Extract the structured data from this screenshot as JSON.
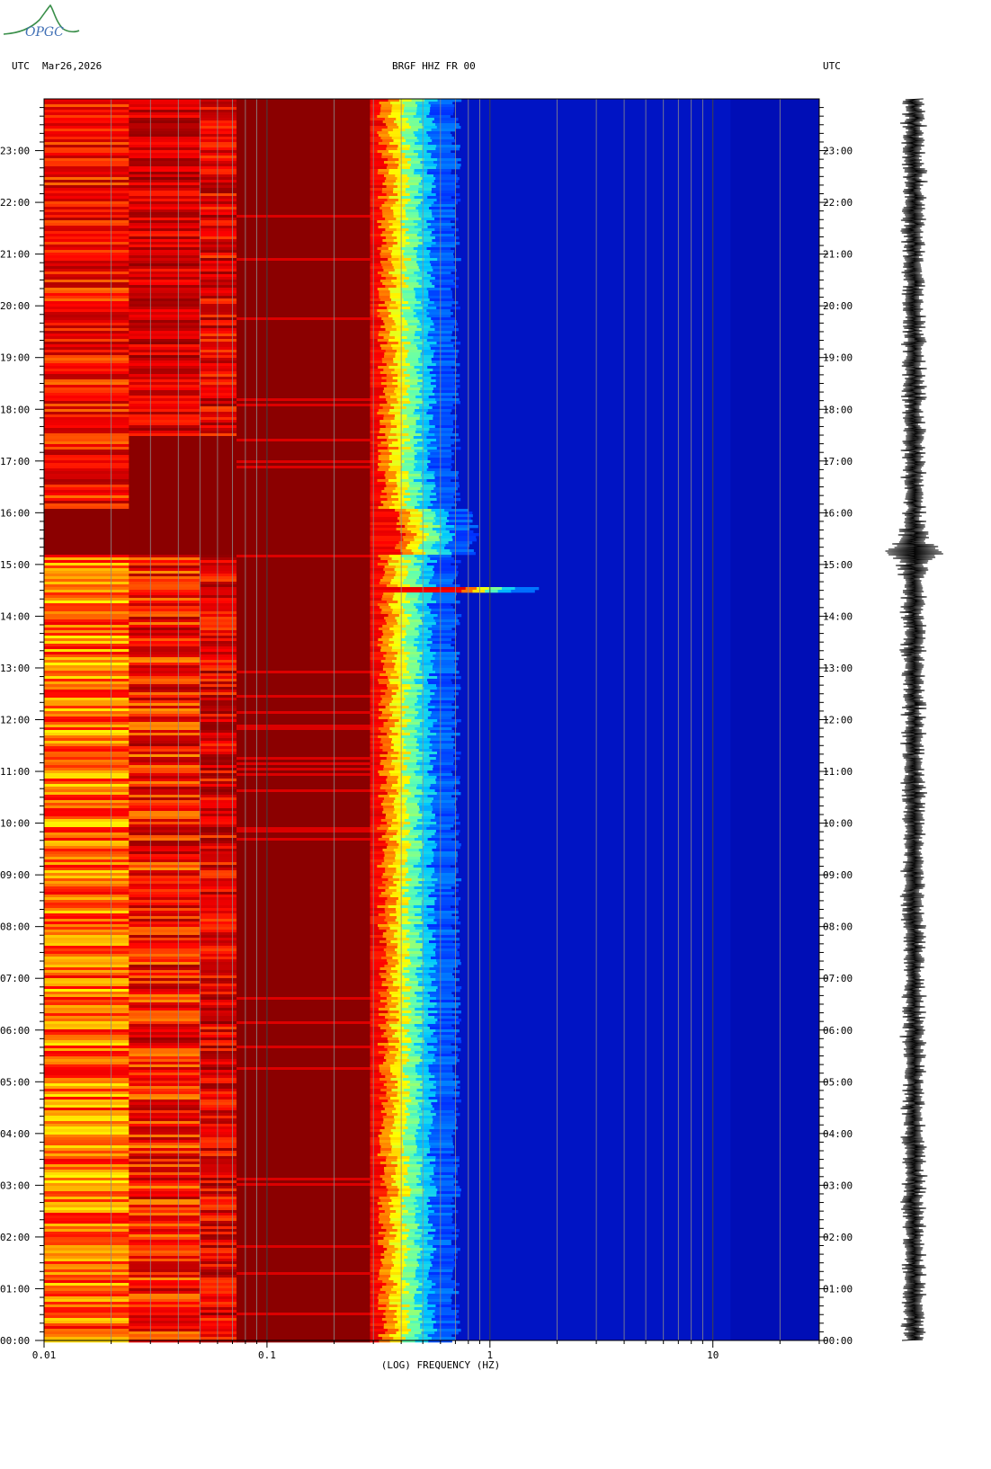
{
  "header": {
    "left_label": "UTC",
    "date": "Mar26,2026",
    "station": "BRGF HHZ FR 00",
    "right_label": "UTC"
  },
  "logo": {
    "text": "OPGC",
    "color": "#3a8f4a",
    "text_color": "#3f6fb5"
  },
  "chart_data": {
    "type": "heatmap",
    "title": "BRGF HHZ FR 00",
    "xlabel": "(LOG) FREQUENCY (HZ)",
    "x_scale": "log",
    "xlim": [
      0.01,
      30
    ],
    "x_ticks": [
      {
        "value": 0.01,
        "label": "0.01"
      },
      {
        "value": 0.1,
        "label": "0.1"
      },
      {
        "value": 1,
        "label": "1"
      },
      {
        "value": 10,
        "label": "10"
      }
    ],
    "y_unit": "hours UTC",
    "ylim": [
      0,
      24
    ],
    "y_ticks": [
      {
        "value": 0,
        "label": "00:00"
      },
      {
        "value": 1,
        "label": "01:00"
      },
      {
        "value": 2,
        "label": "02:00"
      },
      {
        "value": 3,
        "label": "03:00"
      },
      {
        "value": 4,
        "label": "04:00"
      },
      {
        "value": 5,
        "label": "05:00"
      },
      {
        "value": 6,
        "label": "06:00"
      },
      {
        "value": 7,
        "label": "07:00"
      },
      {
        "value": 8,
        "label": "08:00"
      },
      {
        "value": 9,
        "label": "09:00"
      },
      {
        "value": 10,
        "label": "10:00"
      },
      {
        "value": 11,
        "label": "11:00"
      },
      {
        "value": 12,
        "label": "12:00"
      },
      {
        "value": 13,
        "label": "13:00"
      },
      {
        "value": 14,
        "label": "14:00"
      },
      {
        "value": 15,
        "label": "15:00"
      },
      {
        "value": 16,
        "label": "16:00"
      },
      {
        "value": 17,
        "label": "17:00"
      },
      {
        "value": 18,
        "label": "18:00"
      },
      {
        "value": 19,
        "label": "19:00"
      },
      {
        "value": 20,
        "label": "20:00"
      },
      {
        "value": 21,
        "label": "21:00"
      },
      {
        "value": 22,
        "label": "22:00"
      },
      {
        "value": 23,
        "label": "23:00"
      }
    ],
    "frequency_bands_hz": [
      {
        "from": 0.01,
        "to": 0.024,
        "level": "high"
      },
      {
        "from": 0.024,
        "to": 0.05,
        "level": "very-high"
      },
      {
        "from": 0.05,
        "to": 0.073,
        "level": "very-high"
      },
      {
        "from": 0.073,
        "to": 0.1,
        "level": "saturated"
      },
      {
        "from": 0.1,
        "to": 0.3,
        "level": "saturated"
      },
      {
        "from": 0.3,
        "to": 0.5,
        "level": "transition"
      },
      {
        "from": 0.5,
        "to": 30,
        "level": "low"
      }
    ],
    "events_hours": [
      {
        "start": 15.2,
        "end": 16.1,
        "note": "saturated band across low frequencies"
      },
      {
        "start": 14.48,
        "end": 14.56,
        "note": "broadband spike up to about 1.5 Hz"
      }
    ],
    "grid": true,
    "colormap": [
      "#00009a",
      "#0030ff",
      "#00c8ff",
      "#60ffb0",
      "#ffff00",
      "#ff8c00",
      "#ff0000",
      "#8b0000"
    ]
  },
  "seismogram": {
    "color": "#000000",
    "event_hour": 15.25
  }
}
